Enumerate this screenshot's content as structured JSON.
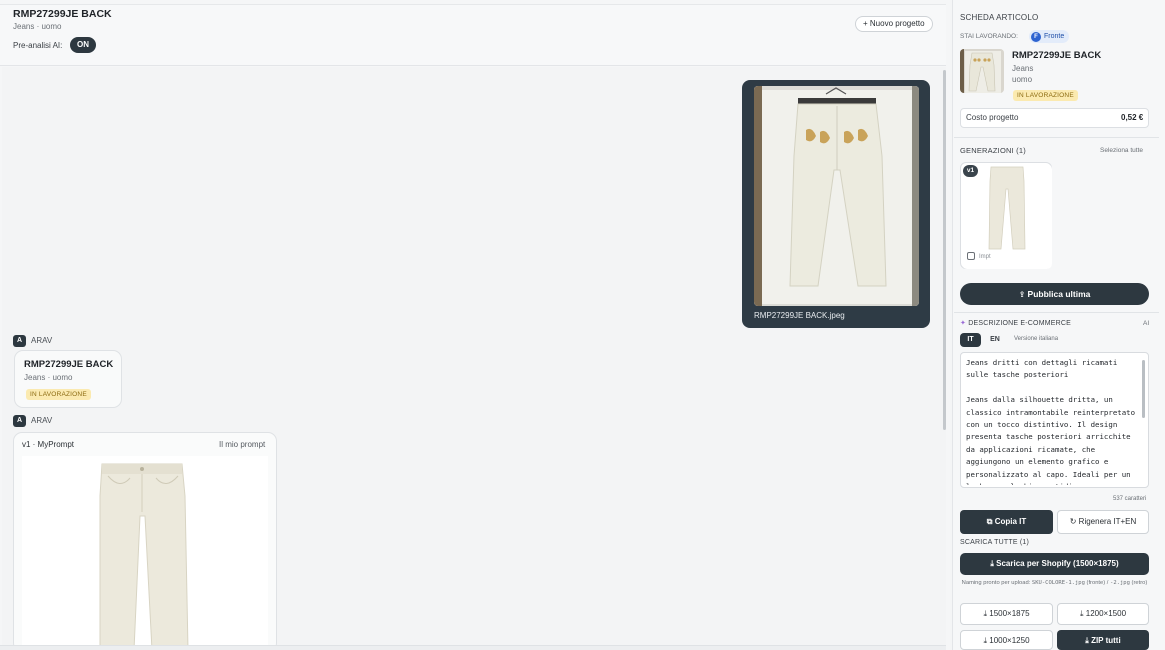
{
  "header": {
    "title": "RMP27299JE BACK",
    "subtitle": "Jeans · uomo",
    "pre_analysis_label": "Pre-analisi AI:",
    "pre_analysis_state": "ON",
    "new_project_label": "+ Nuovo progetto"
  },
  "chat": {
    "uploaded_image_caption": "RMP27299JE BACK.jpeg",
    "messages": [
      {
        "author_initial": "A",
        "author": "ARAV",
        "card_title": "RMP27299JE BACK",
        "card_subtitle": "Jeans · uomo",
        "card_badge": "IN LAVORAZIONE"
      },
      {
        "author_initial": "A",
        "author": "ARAV",
        "gen_title": "v1 · MyPrompt",
        "gen_tag": "Il mio prompt"
      }
    ]
  },
  "sidebar": {
    "section_title": "SCHEDA ARTICOLO",
    "working_on_label": "STAI LAVORANDO:",
    "working_on_view_initial": "F",
    "working_on_view": "Fronte",
    "article": {
      "title": "RMP27299JE BACK",
      "category": "Jeans",
      "gender": "uomo",
      "status": "IN LAVORAZIONE"
    },
    "cost_label": "Costo progetto",
    "cost_value": "0,52 €",
    "generations_label": "GENERAZIONI (1)",
    "select_all_label": "Seleziona tutte",
    "generation_version": "v1",
    "generation_checkbox_label": "Impt",
    "publish_label": "Pubblica ultima",
    "description_label": "DESCRIZIONE E-COMMERCE",
    "description_ai_label": "AI",
    "lang_tabs": [
      "IT",
      "EN"
    ],
    "lang_version_label": "Versione italiana",
    "description_text": "Jeans dritti con dettagli ricamati sulle tasche posteriori\n\nJeans dalla silhouette dritta, un classico intramontabile reinterpretato con un tocco distintivo. Il design presenta tasche posteriori arricchite da applicazioni ricamate, che aggiungono un elemento grafico e personalizzato al capo. Ideali per un look casual chic quotidiano o per elevare un outfit da",
    "char_count": "537 caratteri",
    "copy_label": "Copia IT",
    "regenerate_label": "Rigenera IT+EN",
    "download_all_label": "SCARICA TUTTE (1)",
    "shopify_label": "Scarica per Shopify (1500×1875)",
    "naming_prefix": "Naming pronto per upload: ",
    "naming_code_1": "SKU-COLORE-1.jpg",
    "naming_mid": " (fronte) / ",
    "naming_code_2": "-2.jpg",
    "naming_suffix": " (retro)",
    "size_buttons": [
      "1500×1875",
      "1200×1500",
      "1000×1250"
    ],
    "zip_label": "ZIP tutti"
  }
}
